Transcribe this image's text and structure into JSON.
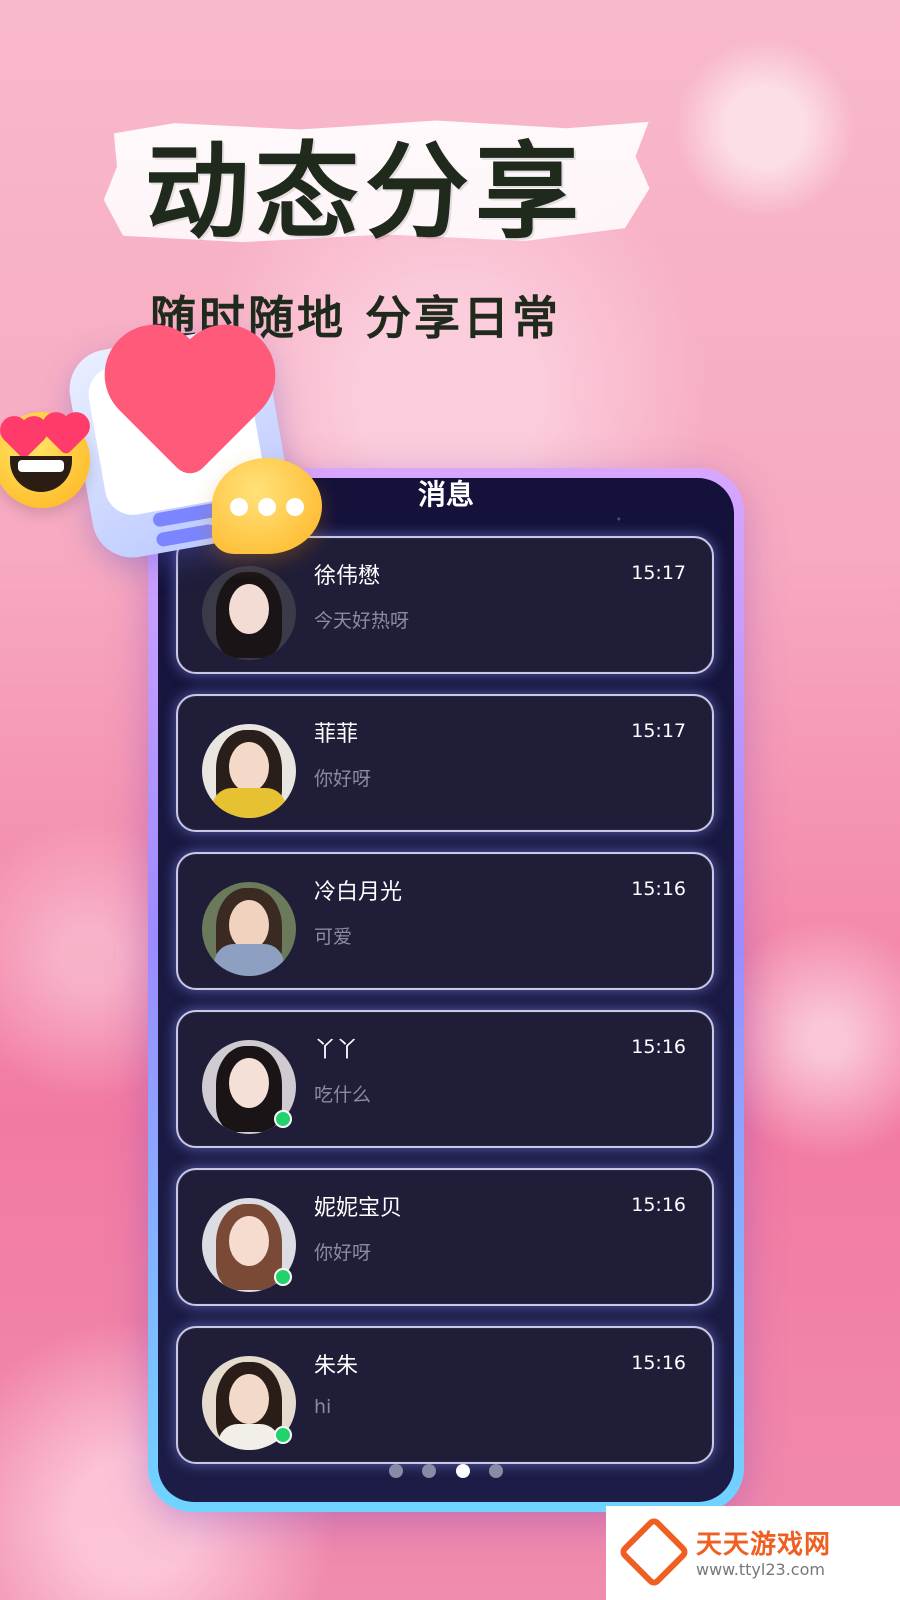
{
  "promo": {
    "headline": "动态分享",
    "subline": "随时随地 分享日常"
  },
  "screen": {
    "title": "消息"
  },
  "messages": [
    {
      "name": "徐伟懋",
      "preview": "今天好热呀",
      "time": "15:17",
      "online": false
    },
    {
      "name": "菲菲",
      "preview": "你好呀",
      "time": "15:17",
      "online": false
    },
    {
      "name": "冷白月光",
      "preview": "可爱",
      "time": "15:16",
      "online": false
    },
    {
      "name": "丫丫",
      "preview": "吃什么",
      "time": "15:16",
      "online": true
    },
    {
      "name": "妮妮宝贝",
      "preview": "你好呀",
      "time": "15:16",
      "online": true
    },
    {
      "name": "朱朱",
      "preview": "hi",
      "time": "15:16",
      "online": true
    }
  ],
  "pager": {
    "count": 4,
    "active_index": 2
  },
  "watermark": {
    "brand": "天天游戏网",
    "url": "www.ttyl23.com"
  },
  "colors": {
    "online": "#22d36b",
    "card_border": "#c9c8e8",
    "screen_bg": "#1a1942"
  },
  "icons": [
    "heart-sticker-icon",
    "heart-eyes-emoji-icon",
    "chat-bubble-icon",
    "watermark-logo-icon"
  ]
}
